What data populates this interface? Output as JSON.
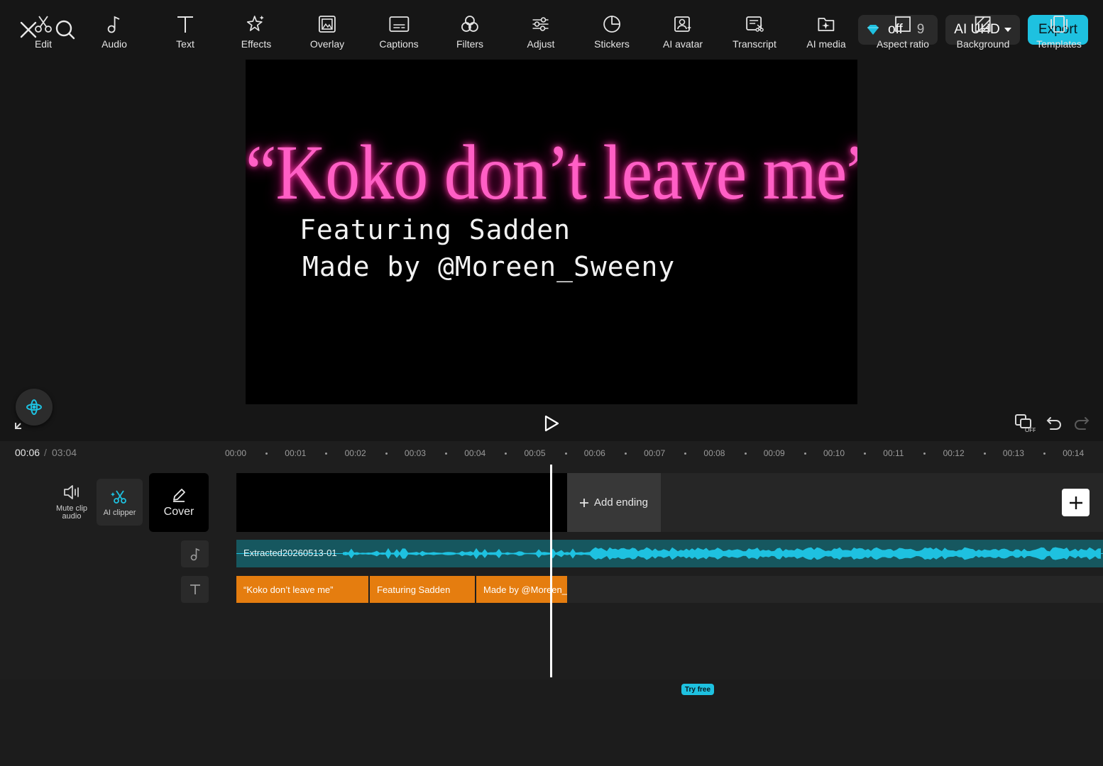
{
  "topbar": {
    "promo_text": "off",
    "promo_count": "9",
    "resolution_label": "AI UHD",
    "export_label": "Export"
  },
  "preview": {
    "title_line": "“Koko don’t leave me”",
    "featuring_line": "Featuring Sadden",
    "made_by_line": "Made by @Moreen_Sweeny"
  },
  "timeline": {
    "current_time": "00:06",
    "separator": "/",
    "total_time": "03:04",
    "ruler": [
      "00:00",
      "00:01",
      "00:02",
      "00:03",
      "00:04",
      "00:05",
      "00:06",
      "00:07",
      "00:08",
      "00:09",
      "00:10",
      "00:11",
      "00:12",
      "00:13",
      "00:14"
    ],
    "side_tools": {
      "mute_label": "Mute clip audio",
      "ai_clipper_label": "AI clipper",
      "cover_label": "Cover"
    },
    "add_ending_label": "Add ending",
    "audio_clip_name": "Extracted20260513-01",
    "text_clips": [
      "“Koko don’t leave me”",
      "Featuring Sadden",
      "Made by @Moreen_"
    ]
  },
  "toolbar": {
    "items": [
      "Edit",
      "Audio",
      "Text",
      "Effects",
      "Overlay",
      "Captions",
      "Filters",
      "Adjust",
      "Stickers",
      "AI avatar",
      "Transcript",
      "AI media",
      "Aspect ratio",
      "Background",
      "Templates"
    ],
    "try_free_badge": "Try free"
  },
  "colors": {
    "accent": "#1ec1e0",
    "text_clip": "#e57d0f",
    "audio_track": "#16575f",
    "neon_pink": "#ff5fc5"
  }
}
